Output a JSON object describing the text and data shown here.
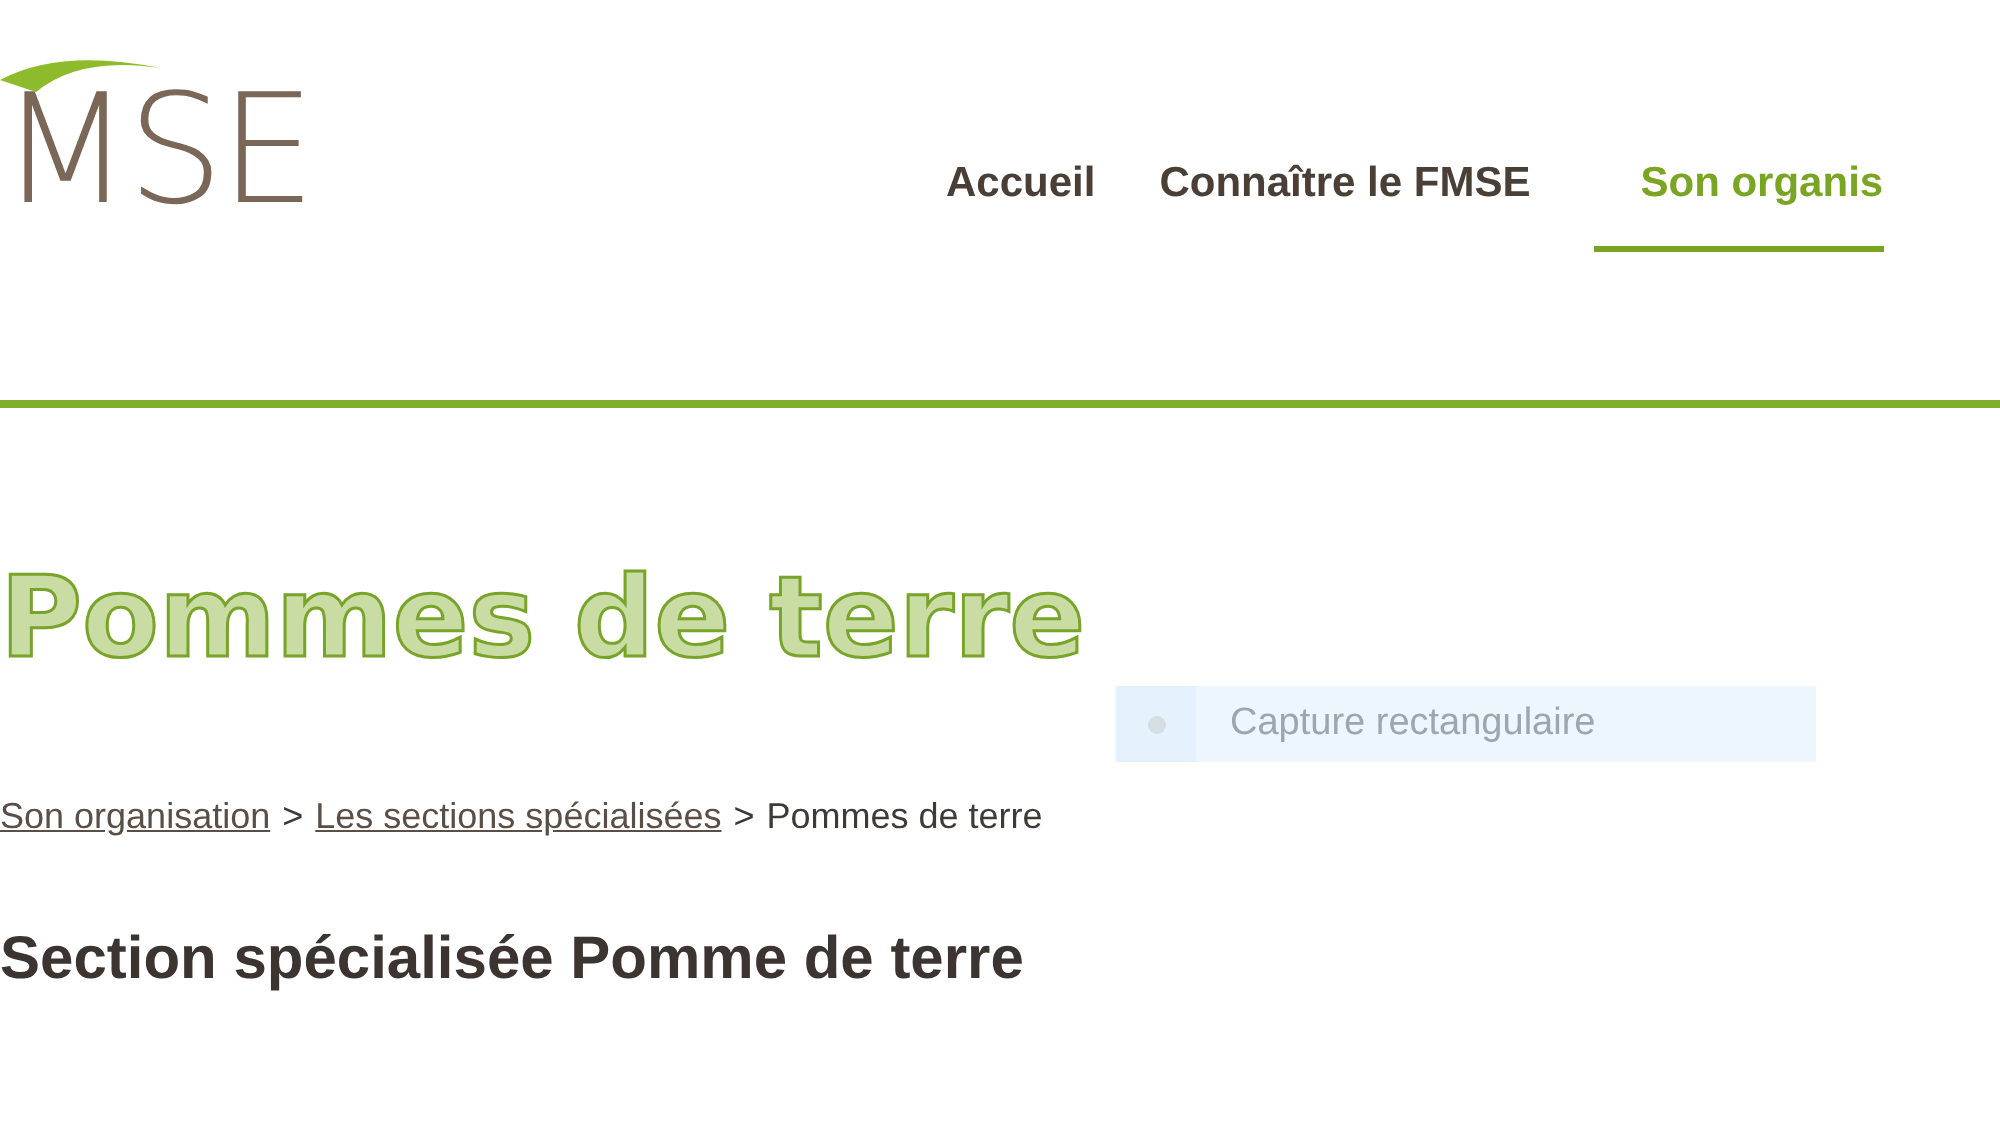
{
  "logo": {
    "text": "MSE"
  },
  "nav": [
    {
      "label": "Accueil",
      "selected": false
    },
    {
      "label": "Connaître le FMSE",
      "selected": false
    },
    {
      "label": "Son organis",
      "selected": true
    }
  ],
  "title": "Pommes de terre",
  "breadcrumb": [
    {
      "label": "Son organisation",
      "link": true
    },
    {
      "label": "Les sections spécialisées",
      "link": true
    },
    {
      "label": "Pommes de terre",
      "link": false
    }
  ],
  "breadcrumb_separator": ">",
  "heading": "Section spécialisée Pomme de terre",
  "tooltip": {
    "label": "Capture rectangulaire"
  }
}
